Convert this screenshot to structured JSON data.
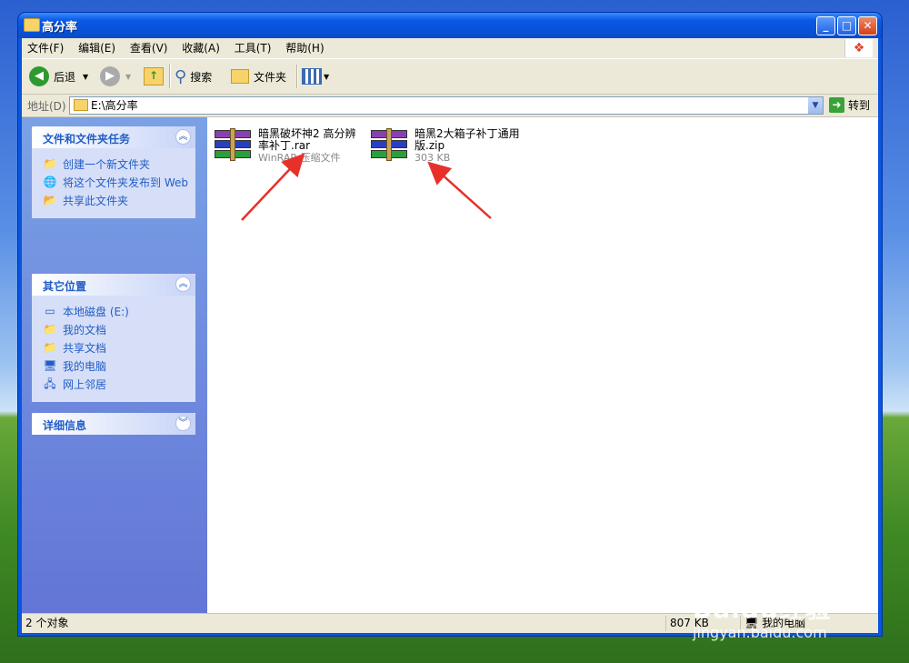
{
  "window": {
    "title": "高分率",
    "controls": {
      "minimize": "_",
      "maximize": "□",
      "close": "✕"
    }
  },
  "menubar": [
    "文件(F)",
    "编辑(E)",
    "查看(V)",
    "收藏(A)",
    "工具(T)",
    "帮助(H)"
  ],
  "toolbar": {
    "back_label": "后退",
    "search_label": "搜索",
    "folders_label": "文件夹"
  },
  "address": {
    "label": "地址(D)",
    "value": "E:\\高分率",
    "go_label": "转到"
  },
  "tasks_panel": {
    "title": "文件和文件夹任务",
    "items": [
      "创建一个新文件夹",
      "将这个文件夹发布到 Web",
      "共享此文件夹"
    ]
  },
  "places_panel": {
    "title": "其它位置",
    "items": [
      "本地磁盘 (E:)",
      "我的文档",
      "共享文档",
      "我的电脑",
      "网上邻居"
    ]
  },
  "details_panel": {
    "title": "详细信息"
  },
  "files": [
    {
      "name_line1": "暗黑破坏神2 高分辨",
      "name_line2": "率补丁.rar",
      "meta": "WinRAR 压缩文件"
    },
    {
      "name_line1": "暗黑2大箱子补丁通用",
      "name_line2": "版.zip",
      "meta": "303 KB"
    }
  ],
  "statusbar": {
    "objects": "2 个对象",
    "size": "807 KB",
    "location": "我的电脑"
  },
  "watermark": {
    "brand": "Baidu经验",
    "site": "jingyan.baidu.com"
  },
  "colors": {
    "title_blue": "#0a55e0",
    "link_blue": "#215dc6",
    "arrow_red": "#e8302a"
  }
}
